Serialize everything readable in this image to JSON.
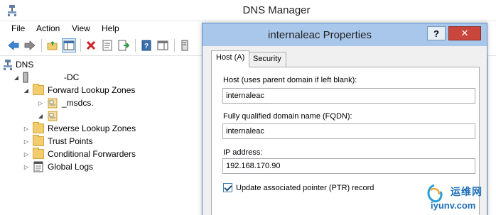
{
  "window": {
    "title": "DNS Manager"
  },
  "menu": [
    "File",
    "Action",
    "View",
    "Help"
  ],
  "tree": {
    "root": "DNS",
    "server": "-DC",
    "forward_zones": "Forward Lookup Zones",
    "msdcs": "_msdcs.",
    "zone_unnamed": "",
    "reverse_zones": "Reverse Lookup Zones",
    "trust_points": "Trust Points",
    "conditional_forwarders": "Conditional Forwarders",
    "global_logs": "Global Logs"
  },
  "dialog": {
    "title": "internaleac Properties",
    "help": "?",
    "close": "✕",
    "tabs": [
      "Host (A)",
      "Security"
    ],
    "host_label": "Host (uses parent domain if left blank):",
    "host_value": "internaleac",
    "fqdn_label": "Fully qualified domain name (FQDN):",
    "fqdn_value": "internaleac",
    "ip_label": "IP address:",
    "ip_value": "192.168.170.90",
    "ptr_label": "Update associated pointer (PTR) record",
    "ptr_checked": true
  },
  "watermark": {
    "cn": "运维网",
    "url": "iyunv.com"
  },
  "colors": {
    "dialog_title_bg": "#a9c7ea",
    "close_red": "#c9463d",
    "folder": "#f1cd6e"
  }
}
